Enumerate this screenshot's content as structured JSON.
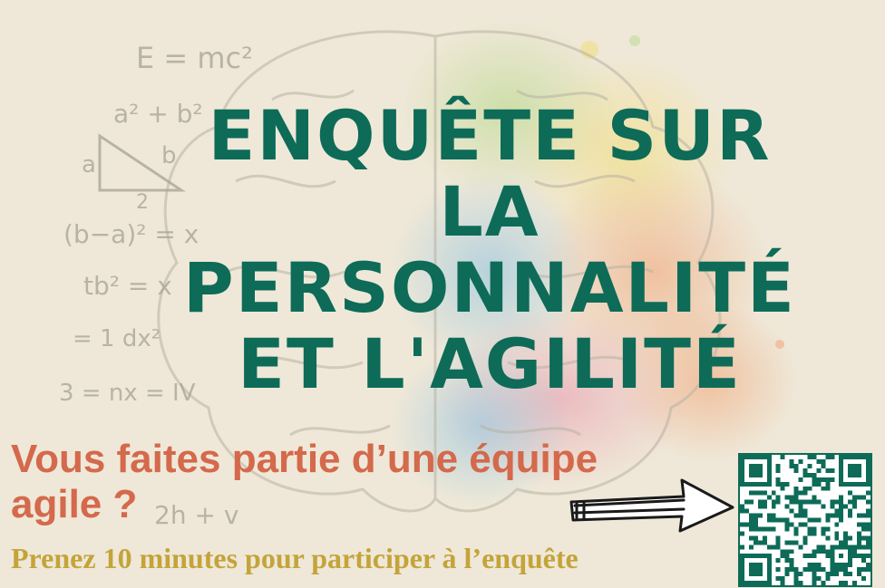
{
  "poster": {
    "title_lines": [
      "ENQUÊTE SUR",
      "LA",
      "PERSONNALITÉ",
      "ET L'AGILITÉ"
    ],
    "subtitle_lines": [
      "Vous faites partie d’une équipe",
      "agile ?"
    ],
    "cta": "Prenez 10 minutes pour participer à l’enquête"
  },
  "decorations": {
    "formulas": [
      "E = mc²",
      "a² + b²",
      "a",
      "b",
      "2",
      "(b−a)² = x",
      "tb² = x",
      "= 1 dx²",
      "3 = nx = IV",
      "2h + v"
    ],
    "icons": [
      "brain-illustration-icon",
      "arrow-right-icon",
      "qr-code-icon"
    ]
  },
  "colors": {
    "background": "#efe8d8",
    "title": "#0d6b58",
    "subtitle": "#d4694c",
    "cta": "#c4a43a"
  }
}
